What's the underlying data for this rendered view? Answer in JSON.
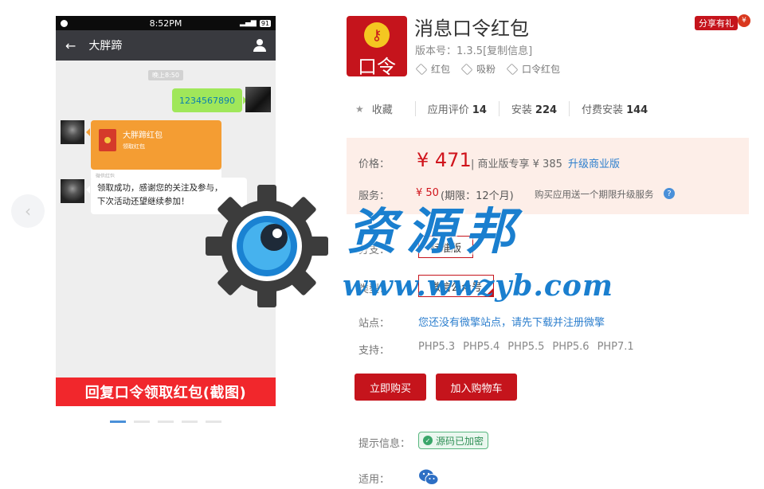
{
  "gallery": {
    "prev_glyph": "‹",
    "status_time": "8:52PM",
    "status_right": "91",
    "chat_title": "大胖蹄",
    "back_glyph": "←",
    "time_stamp": "晚上8:50",
    "my_message": "1234567890",
    "redpacket_title": "大胖蹄红包",
    "redpacket_sub": "领取红包",
    "redpacket_footer": "微信红包",
    "reply_line1": "领取成功，感谢您的关注及参与，",
    "reply_line2": "下次活动还望继续参加！",
    "banner": "回复口令领取红包(截图)",
    "dots_total": 5,
    "dots_active_index": 0
  },
  "watermark": {
    "text": "资源邦",
    "url": "www.wwzyb.com"
  },
  "app": {
    "icon_text": "口令",
    "title": "消息口令红包",
    "version": "版本号：1.3.5[复制信息]",
    "tags": [
      "红包",
      "吸粉",
      "口令红包"
    ],
    "share": "分享有礼",
    "share_gift": "¥"
  },
  "stats": {
    "fav_label": "收藏",
    "rating_label": "应用评价",
    "rating_value": "14",
    "install_label": "安装",
    "install_value": "224",
    "paid_label": "付费安装",
    "paid_value": "144"
  },
  "price": {
    "label": "价格：",
    "value": "¥ 471",
    "pro_text": "| 商业版专享 ¥ 385",
    "upgrade": "升级商业版",
    "service_label": "服务：",
    "service_value": "¥ 50",
    "service_period": "(期限：12个月)",
    "service_note": "购买应用送一个期限升级服务",
    "help": "?"
  },
  "options": {
    "branch_label": "分支：",
    "branch_value": "标准版",
    "type_label": "类型：",
    "type_value": "微信公众号",
    "site_label": "站点：",
    "site_link": "您还没有微擎站点，请先下载并注册微擎",
    "support_label": "支持：",
    "support": [
      "PHP5.3",
      "PHP5.4",
      "PHP5.5",
      "PHP5.6",
      "PHP7.1"
    ]
  },
  "actions": {
    "buy": "立即购买",
    "cart": "加入购物车"
  },
  "meta": {
    "hint_label": "提示信息：",
    "hint_badge": "源码已加密",
    "apply_label": "适用："
  }
}
